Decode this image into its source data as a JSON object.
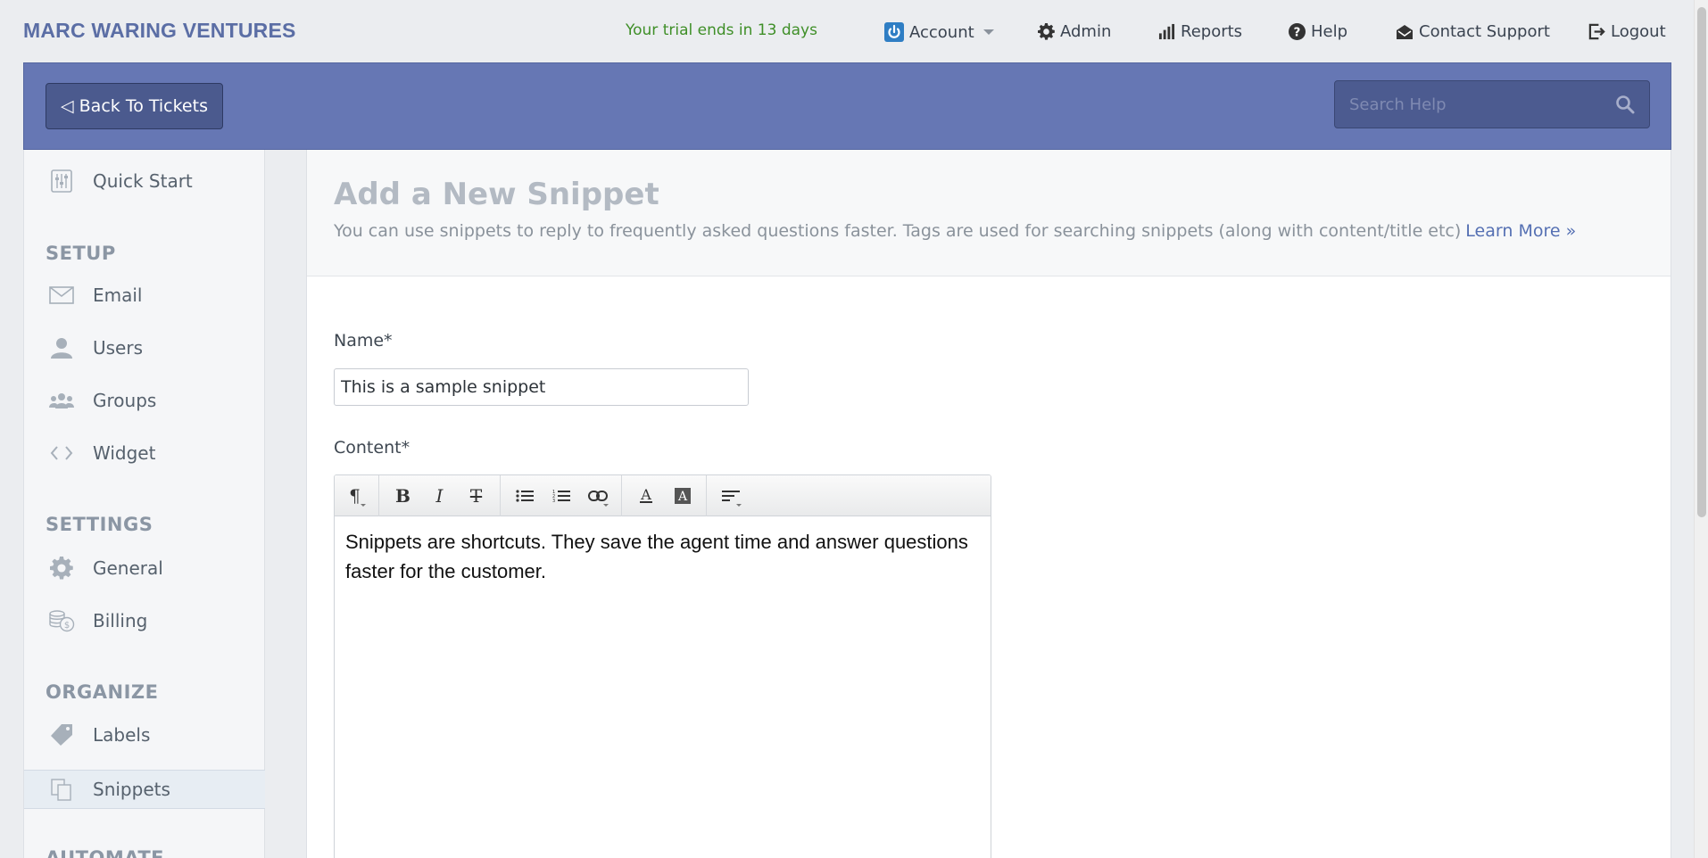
{
  "brand": "MARC WARING VENTURES",
  "trial_notice": "Your trial ends in 13 days",
  "topnav": {
    "account": "Account",
    "admin": "Admin",
    "reports": "Reports",
    "help": "Help",
    "contact": "Contact Support",
    "logout": "Logout"
  },
  "header": {
    "back_label": "◁ Back To Tickets",
    "search_placeholder": "Search Help"
  },
  "sidebar": {
    "quick_start": "Quick Start",
    "setup_heading": "SETUP",
    "setup_items": [
      "Email",
      "Users",
      "Groups",
      "Widget"
    ],
    "settings_heading": "SETTINGS",
    "settings_items": [
      "General",
      "Billing"
    ],
    "organize_heading": "ORGANIZE",
    "organize_items": [
      "Labels",
      "Snippets"
    ],
    "automate_heading": "AUTOMATE",
    "active": "Snippets"
  },
  "main": {
    "title": "Add a New Snippet",
    "description": "You can use snippets to reply to frequently asked questions faster. Tags are used for searching snippets (along with content/title etc)",
    "learn_more": "Learn More »",
    "name_label": "Name*",
    "name_value": "This is a sample snippet",
    "content_label": "Content*",
    "content_text": "Snippets are shortcuts. They save the agent time and answer questions faster for the customer."
  },
  "colors": {
    "brand": "#5b6ea5",
    "header_bar": "#6677b4",
    "trial_green": "#3f8f28",
    "link": "#5570b3"
  }
}
